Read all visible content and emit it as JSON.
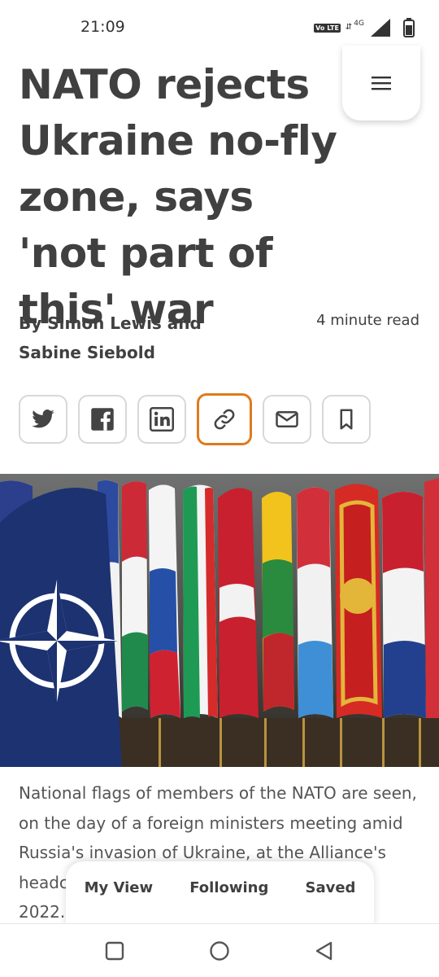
{
  "status_bar": {
    "time": "21:09",
    "volte_label": "Vo LTE",
    "network_label": "4G",
    "icons": [
      "volte-icon",
      "signal-icon",
      "battery-icon"
    ]
  },
  "menu": {
    "icon": "hamburger-menu-icon"
  },
  "article": {
    "headline": "NATO rejects Ukraine no-fly zone, says 'not part of this' war",
    "byline": "By Simon Lewis and Sabine Siebold",
    "read_time": "4 minute read",
    "share_buttons": [
      {
        "icon": "twitter-icon"
      },
      {
        "icon": "facebook-icon"
      },
      {
        "icon": "linkedin-icon"
      },
      {
        "icon": "link-icon",
        "active": true
      },
      {
        "icon": "email-icon"
      },
      {
        "icon": "bookmark-icon"
      }
    ],
    "image_caption": "National flags of members of the NATO are seen, on the day of a foreign ministers meeting amid Russia's invasion of Ukraine, at the Alliance's headc",
    "caption_line_end": "2022."
  },
  "bottom_tabs": {
    "my_view": "My View",
    "following": "Following",
    "saved": "Saved"
  },
  "system_nav": [
    "recents-square-icon",
    "home-circle-icon",
    "back-triangle-icon"
  ],
  "colors": {
    "accent": "#e07a1e",
    "text": "#404040"
  }
}
